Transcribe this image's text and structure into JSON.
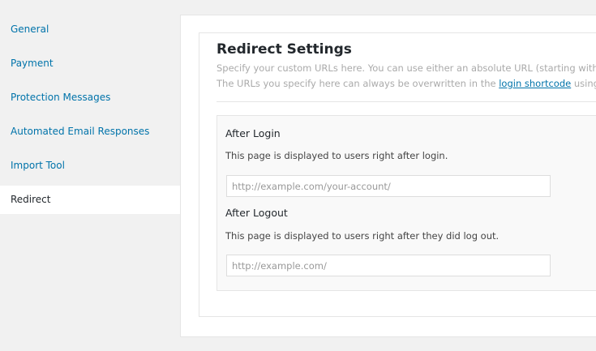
{
  "sidebar": {
    "items": [
      {
        "label": "General"
      },
      {
        "label": "Payment"
      },
      {
        "label": "Protection Messages"
      },
      {
        "label": "Automated Email Responses"
      },
      {
        "label": "Import Tool"
      },
      {
        "label": "Redirect"
      }
    ]
  },
  "section": {
    "title": "Redirect Settings",
    "desc_line1": "Specify your custom URLs here. You can use either an absolute URL (starting with \"http",
    "desc_line2_before": "The URLs you specify here can always be overwritten in the ",
    "desc_link": "login shortcode",
    "desc_line2_after": " using the r"
  },
  "fields": {
    "after_login": {
      "title": "After Login",
      "desc": "This page is displayed to users right after login.",
      "value": "",
      "placeholder": "http://example.com/your-account/"
    },
    "after_logout": {
      "title": "After Logout",
      "desc": "This page is displayed to users right after they did log out.",
      "value": "",
      "placeholder": "http://example.com/"
    }
  }
}
